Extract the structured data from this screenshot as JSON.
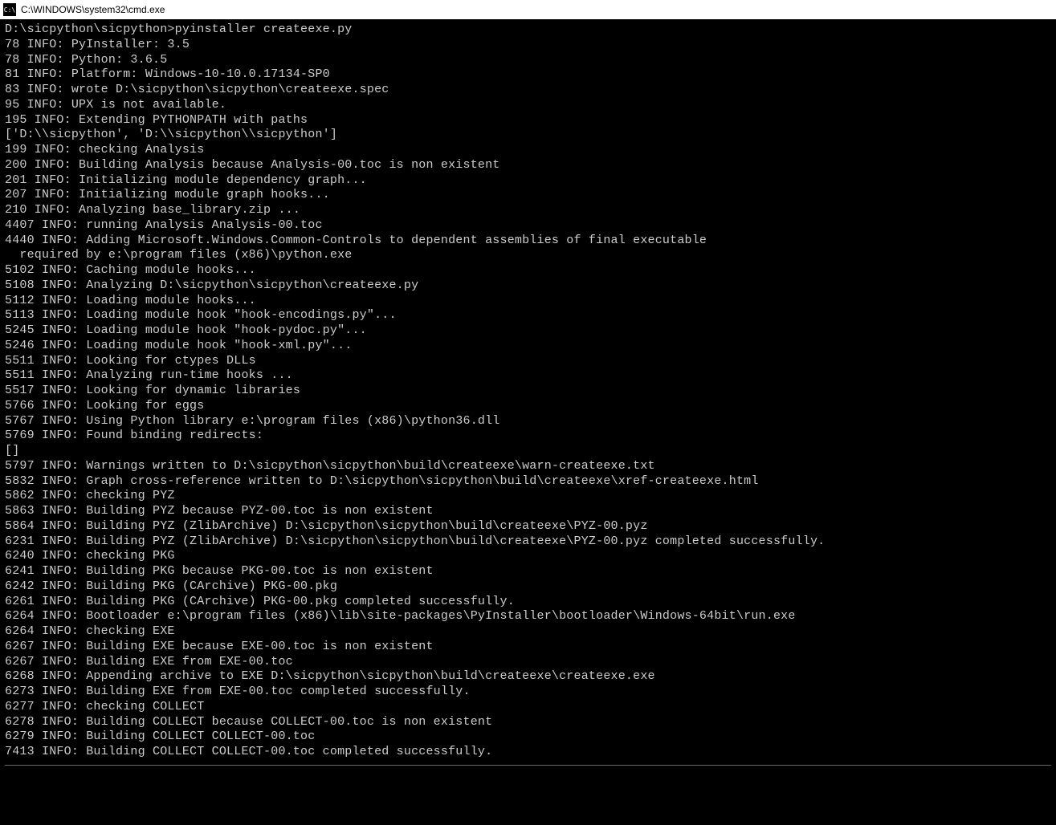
{
  "window": {
    "title": "C:\\WINDOWS\\system32\\cmd.exe",
    "icon_label": "C:\\"
  },
  "terminal": {
    "lines": [
      "D:\\sicpython\\sicpython>pyinstaller createexe.py",
      "78 INFO: PyInstaller: 3.5",
      "78 INFO: Python: 3.6.5",
      "81 INFO: Platform: Windows-10-10.0.17134-SP0",
      "83 INFO: wrote D:\\sicpython\\sicpython\\createexe.spec",
      "95 INFO: UPX is not available.",
      "195 INFO: Extending PYTHONPATH with paths",
      "['D:\\\\sicpython', 'D:\\\\sicpython\\\\sicpython']",
      "199 INFO: checking Analysis",
      "200 INFO: Building Analysis because Analysis-00.toc is non existent",
      "201 INFO: Initializing module dependency graph...",
      "207 INFO: Initializing module graph hooks...",
      "210 INFO: Analyzing base_library.zip ...",
      "4407 INFO: running Analysis Analysis-00.toc",
      "4440 INFO: Adding Microsoft.Windows.Common-Controls to dependent assemblies of final executable",
      "  required by e:\\program files (x86)\\python.exe",
      "5102 INFO: Caching module hooks...",
      "5108 INFO: Analyzing D:\\sicpython\\sicpython\\createexe.py",
      "5112 INFO: Loading module hooks...",
      "5113 INFO: Loading module hook \"hook-encodings.py\"...",
      "5245 INFO: Loading module hook \"hook-pydoc.py\"...",
      "5246 INFO: Loading module hook \"hook-xml.py\"...",
      "5511 INFO: Looking for ctypes DLLs",
      "5511 INFO: Analyzing run-time hooks ...",
      "5517 INFO: Looking for dynamic libraries",
      "5766 INFO: Looking for eggs",
      "5767 INFO: Using Python library e:\\program files (x86)\\python36.dll",
      "5769 INFO: Found binding redirects:",
      "[]",
      "5797 INFO: Warnings written to D:\\sicpython\\sicpython\\build\\createexe\\warn-createexe.txt",
      "5832 INFO: Graph cross-reference written to D:\\sicpython\\sicpython\\build\\createexe\\xref-createexe.html",
      "5862 INFO: checking PYZ",
      "5863 INFO: Building PYZ because PYZ-00.toc is non existent",
      "5864 INFO: Building PYZ (ZlibArchive) D:\\sicpython\\sicpython\\build\\createexe\\PYZ-00.pyz",
      "6231 INFO: Building PYZ (ZlibArchive) D:\\sicpython\\sicpython\\build\\createexe\\PYZ-00.pyz completed successfully.",
      "6240 INFO: checking PKG",
      "6241 INFO: Building PKG because PKG-00.toc is non existent",
      "6242 INFO: Building PKG (CArchive) PKG-00.pkg",
      "6261 INFO: Building PKG (CArchive) PKG-00.pkg completed successfully.",
      "6264 INFO: Bootloader e:\\program files (x86)\\lib\\site-packages\\PyInstaller\\bootloader\\Windows-64bit\\run.exe",
      "6264 INFO: checking EXE",
      "6267 INFO: Building EXE because EXE-00.toc is non existent",
      "6267 INFO: Building EXE from EXE-00.toc",
      "6268 INFO: Appending archive to EXE D:\\sicpython\\sicpython\\build\\createexe\\createexe.exe",
      "6273 INFO: Building EXE from EXE-00.toc completed successfully.",
      "6277 INFO: checking COLLECT",
      "6278 INFO: Building COLLECT because COLLECT-00.toc is non existent",
      "6279 INFO: Building COLLECT COLLECT-00.toc",
      "7413 INFO: Building COLLECT COLLECT-00.toc completed successfully."
    ]
  }
}
